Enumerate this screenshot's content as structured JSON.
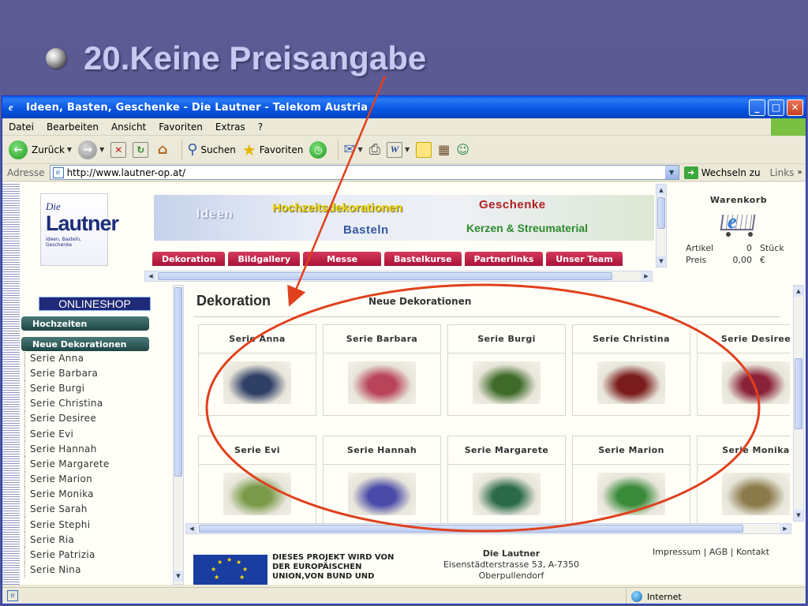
{
  "slide": {
    "title": "20.Keine Preisangabe"
  },
  "window": {
    "title": "Ideen, Basten, Geschenke - Die Lautner - Telekom Austria",
    "controls": [
      "_",
      "□",
      "✕"
    ]
  },
  "menu": [
    "Datei",
    "Bearbeiten",
    "Ansicht",
    "Favoriten",
    "Extras",
    "?"
  ],
  "toolbar": {
    "back": "Zurück",
    "search": "Suchen",
    "favorites": "Favoriten"
  },
  "address": {
    "label": "Adresse",
    "url": "http://www.lautner-op.at/",
    "go": "Wechseln zu",
    "links": "Links"
  },
  "logo": {
    "die": "Die",
    "name": "Lautner",
    "tagline": "Ideen, Basteln, Geschenke"
  },
  "banner": {
    "ideen": "Ideen",
    "hochzeit": "Hochzeitsdekorationen",
    "geschenke": "Geschenke",
    "basteln": "Basteln",
    "kerzen": "Kerzen & Streumaterial"
  },
  "nav_tabs": [
    "Dekoration",
    "Bildgallery",
    "Messe",
    "Bastelkurse",
    "Partnerlinks",
    "Unser Team"
  ],
  "cart": {
    "title": "Warenkorb",
    "rows": [
      {
        "label": "Artikel",
        "value": "0",
        "unit": "Stück"
      },
      {
        "label": "Preis",
        "value": "0,00",
        "unit": "€"
      }
    ]
  },
  "sidebar": {
    "header": "ONLINESHOP",
    "categories": [
      "Hochzeiten",
      "Neue Dekorationen"
    ],
    "series": [
      "Serie Anna",
      "Serie Barbara",
      "Serie Burgi",
      "Serie Christina",
      "Serie Desiree",
      "Serie Evi",
      "Serie Hannah",
      "Serie Margarete",
      "Serie Marion",
      "Serie Monika",
      "Serie Sarah",
      "Serie Stephi",
      "Serie Ria",
      "Serie Patrizia",
      "Serie Nina"
    ]
  },
  "content": {
    "title": "Dekoration",
    "subtitle": "Neue Dekorationen",
    "products": [
      {
        "name": "Serie Anna",
        "color": "#2f3f66"
      },
      {
        "name": "Serie Barbara",
        "color": "#b9445a"
      },
      {
        "name": "Serie Burgi",
        "color": "#3f6b2a"
      },
      {
        "name": "Serie Christina",
        "color": "#7a1c1c"
      },
      {
        "name": "Serie Desiree",
        "color": "#8a2238"
      },
      {
        "name": "Serie Evi",
        "color": "#7a9a4a"
      },
      {
        "name": "Serie Hannah",
        "color": "#4a4aa8"
      },
      {
        "name": "Serie Margarete",
        "color": "#2a6a4a"
      },
      {
        "name": "Serie Marion",
        "color": "#3a8a3a"
      },
      {
        "name": "Serie Monika",
        "color": "#8a7a4a"
      }
    ]
  },
  "footer": {
    "eu_text": "DIESES PROJEKT WIRD VON DER EUROPÄISCHEN UNION,VON BUND UND",
    "company": "Die Lautner",
    "street": "Eisenstädterstrasse 53, A-7350",
    "city": "Oberpullendorf",
    "legal": "Impressum | AGB | Kontakt"
  },
  "status": {
    "zone": "Internet"
  }
}
